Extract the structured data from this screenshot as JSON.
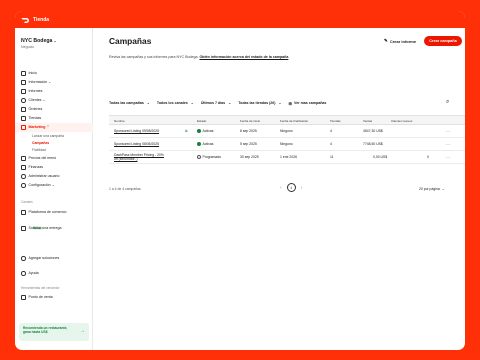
{
  "header": {
    "brand": "Tienda"
  },
  "store": {
    "name": "NYC Bodega",
    "subtitle": "Negocio"
  },
  "sidebar": {
    "items": [
      {
        "label": "Inicio",
        "icon": "home-icon"
      },
      {
        "label": "Información",
        "icon": "chart-icon"
      },
      {
        "label": "Informes",
        "icon": "report-icon"
      },
      {
        "label": "Clientes",
        "icon": "users-icon"
      },
      {
        "label": "Órdenes",
        "icon": "orders-icon"
      },
      {
        "label": "Tiendas",
        "icon": "store-icon"
      },
      {
        "label": "Marketing",
        "icon": "megaphone-icon"
      }
    ],
    "marketing_sub": [
      "Lanzar una campaña",
      "Campañas",
      "Fidelidad"
    ],
    "items2": [
      {
        "label": "Precios del menú",
        "icon": "menu-icon"
      },
      {
        "label": "Finanzas",
        "icon": "finance-icon"
      },
      {
        "label": "Administrar usuario",
        "icon": "admin-icon"
      },
      {
        "label": "Configuración",
        "icon": "gear-icon"
      }
    ],
    "canales_label": "Canales",
    "canales": [
      {
        "label": "Plataforma de comercio",
        "icon": "platform-icon",
        "badge": "Nuevo"
      },
      {
        "label": "Solicitar una entrega",
        "icon": "delivery-icon"
      }
    ],
    "items3": [
      {
        "label": "Agregar soluciones",
        "icon": "plus-icon"
      },
      {
        "label": "Ayuda",
        "icon": "help-icon"
      }
    ],
    "herramientas_label": "Herramientas del vendedor",
    "tools": [
      {
        "label": "Punto de venta",
        "icon": "pos-icon"
      }
    ],
    "promo": {
      "line1": "Recomienda un restaurante,",
      "line2": "gana hasta US$"
    }
  },
  "main": {
    "title": "Campañas",
    "create_report": "Crear informe",
    "create_campaign": "Crear campaña",
    "intro": "Revisa las campañas y sus informes para NYC Bodega.",
    "intro_link": "Obtén información acerca del estado de la campaña",
    "filters": [
      "Todas las campañas",
      "Todos los canales",
      "Últimos 7 días",
      "Todas las tiendas (26)"
    ],
    "view_more": "Ver mas campañas",
    "columns": [
      "Nombre",
      "Estado",
      "Fecha de inicio",
      "Fecha de finalización",
      "Tiendas",
      "Ventas",
      "Clientes nuevos"
    ],
    "rows": [
      {
        "name": "Sponsored Listing 09/08/2025",
        "status": "Activas",
        "start": "8 sep 2025",
        "end": "Ninguno",
        "stores": "4",
        "sales": "4547,30 US$",
        "new": "",
        "scheduled": false
      },
      {
        "name": "Sponsored Listing 08/05/2025",
        "status": "Activas",
        "start": "5 sep 2025",
        "end": "Ninguno",
        "stores": "4",
        "sales": "7748,50 US$",
        "new": "",
        "scheduled": false
      },
      {
        "name": "DashPass Member Pricing - 20%",
        "name2": "off (secondfor..)",
        "status": "Programado",
        "start": "30 sep 2025",
        "end": "1 ene 2026",
        "stores": "11",
        "sales": "0,00 US$",
        "new": "0",
        "scheduled": true
      }
    ],
    "summary": "1 a 4 de 4 campañas",
    "current_page": "1",
    "per_page": "20 por página"
  },
  "colors": {
    "brand": "#ff3008",
    "accent": "#eb1700",
    "active": "#16803c"
  }
}
